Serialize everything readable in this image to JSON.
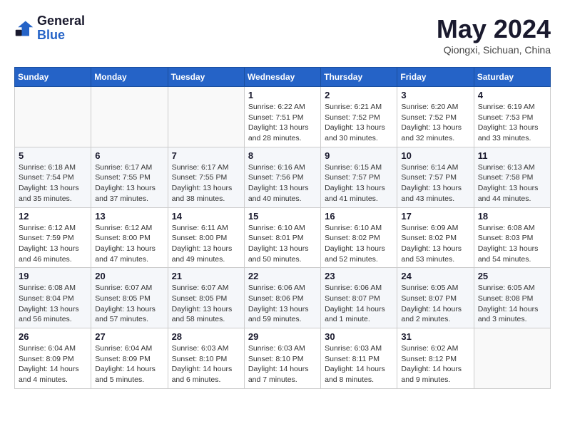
{
  "logo": {
    "line1": "General",
    "line2": "Blue"
  },
  "title": "May 2024",
  "subtitle": "Qiongxi, Sichuan, China",
  "days_of_week": [
    "Sunday",
    "Monday",
    "Tuesday",
    "Wednesday",
    "Thursday",
    "Friday",
    "Saturday"
  ],
  "weeks": [
    [
      {
        "day": "",
        "info": ""
      },
      {
        "day": "",
        "info": ""
      },
      {
        "day": "",
        "info": ""
      },
      {
        "day": "1",
        "info": "Sunrise: 6:22 AM\nSunset: 7:51 PM\nDaylight: 13 hours\nand 28 minutes."
      },
      {
        "day": "2",
        "info": "Sunrise: 6:21 AM\nSunset: 7:52 PM\nDaylight: 13 hours\nand 30 minutes."
      },
      {
        "day": "3",
        "info": "Sunrise: 6:20 AM\nSunset: 7:52 PM\nDaylight: 13 hours\nand 32 minutes."
      },
      {
        "day": "4",
        "info": "Sunrise: 6:19 AM\nSunset: 7:53 PM\nDaylight: 13 hours\nand 33 minutes."
      }
    ],
    [
      {
        "day": "5",
        "info": "Sunrise: 6:18 AM\nSunset: 7:54 PM\nDaylight: 13 hours\nand 35 minutes."
      },
      {
        "day": "6",
        "info": "Sunrise: 6:17 AM\nSunset: 7:55 PM\nDaylight: 13 hours\nand 37 minutes."
      },
      {
        "day": "7",
        "info": "Sunrise: 6:17 AM\nSunset: 7:55 PM\nDaylight: 13 hours\nand 38 minutes."
      },
      {
        "day": "8",
        "info": "Sunrise: 6:16 AM\nSunset: 7:56 PM\nDaylight: 13 hours\nand 40 minutes."
      },
      {
        "day": "9",
        "info": "Sunrise: 6:15 AM\nSunset: 7:57 PM\nDaylight: 13 hours\nand 41 minutes."
      },
      {
        "day": "10",
        "info": "Sunrise: 6:14 AM\nSunset: 7:57 PM\nDaylight: 13 hours\nand 43 minutes."
      },
      {
        "day": "11",
        "info": "Sunrise: 6:13 AM\nSunset: 7:58 PM\nDaylight: 13 hours\nand 44 minutes."
      }
    ],
    [
      {
        "day": "12",
        "info": "Sunrise: 6:12 AM\nSunset: 7:59 PM\nDaylight: 13 hours\nand 46 minutes."
      },
      {
        "day": "13",
        "info": "Sunrise: 6:12 AM\nSunset: 8:00 PM\nDaylight: 13 hours\nand 47 minutes."
      },
      {
        "day": "14",
        "info": "Sunrise: 6:11 AM\nSunset: 8:00 PM\nDaylight: 13 hours\nand 49 minutes."
      },
      {
        "day": "15",
        "info": "Sunrise: 6:10 AM\nSunset: 8:01 PM\nDaylight: 13 hours\nand 50 minutes."
      },
      {
        "day": "16",
        "info": "Sunrise: 6:10 AM\nSunset: 8:02 PM\nDaylight: 13 hours\nand 52 minutes."
      },
      {
        "day": "17",
        "info": "Sunrise: 6:09 AM\nSunset: 8:02 PM\nDaylight: 13 hours\nand 53 minutes."
      },
      {
        "day": "18",
        "info": "Sunrise: 6:08 AM\nSunset: 8:03 PM\nDaylight: 13 hours\nand 54 minutes."
      }
    ],
    [
      {
        "day": "19",
        "info": "Sunrise: 6:08 AM\nSunset: 8:04 PM\nDaylight: 13 hours\nand 56 minutes."
      },
      {
        "day": "20",
        "info": "Sunrise: 6:07 AM\nSunset: 8:05 PM\nDaylight: 13 hours\nand 57 minutes."
      },
      {
        "day": "21",
        "info": "Sunrise: 6:07 AM\nSunset: 8:05 PM\nDaylight: 13 hours\nand 58 minutes."
      },
      {
        "day": "22",
        "info": "Sunrise: 6:06 AM\nSunset: 8:06 PM\nDaylight: 13 hours\nand 59 minutes."
      },
      {
        "day": "23",
        "info": "Sunrise: 6:06 AM\nSunset: 8:07 PM\nDaylight: 14 hours\nand 1 minute."
      },
      {
        "day": "24",
        "info": "Sunrise: 6:05 AM\nSunset: 8:07 PM\nDaylight: 14 hours\nand 2 minutes."
      },
      {
        "day": "25",
        "info": "Sunrise: 6:05 AM\nSunset: 8:08 PM\nDaylight: 14 hours\nand 3 minutes."
      }
    ],
    [
      {
        "day": "26",
        "info": "Sunrise: 6:04 AM\nSunset: 8:09 PM\nDaylight: 14 hours\nand 4 minutes."
      },
      {
        "day": "27",
        "info": "Sunrise: 6:04 AM\nSunset: 8:09 PM\nDaylight: 14 hours\nand 5 minutes."
      },
      {
        "day": "28",
        "info": "Sunrise: 6:03 AM\nSunset: 8:10 PM\nDaylight: 14 hours\nand 6 minutes."
      },
      {
        "day": "29",
        "info": "Sunrise: 6:03 AM\nSunset: 8:10 PM\nDaylight: 14 hours\nand 7 minutes."
      },
      {
        "day": "30",
        "info": "Sunrise: 6:03 AM\nSunset: 8:11 PM\nDaylight: 14 hours\nand 8 minutes."
      },
      {
        "day": "31",
        "info": "Sunrise: 6:02 AM\nSunset: 8:12 PM\nDaylight: 14 hours\nand 9 minutes."
      },
      {
        "day": "",
        "info": ""
      }
    ]
  ]
}
